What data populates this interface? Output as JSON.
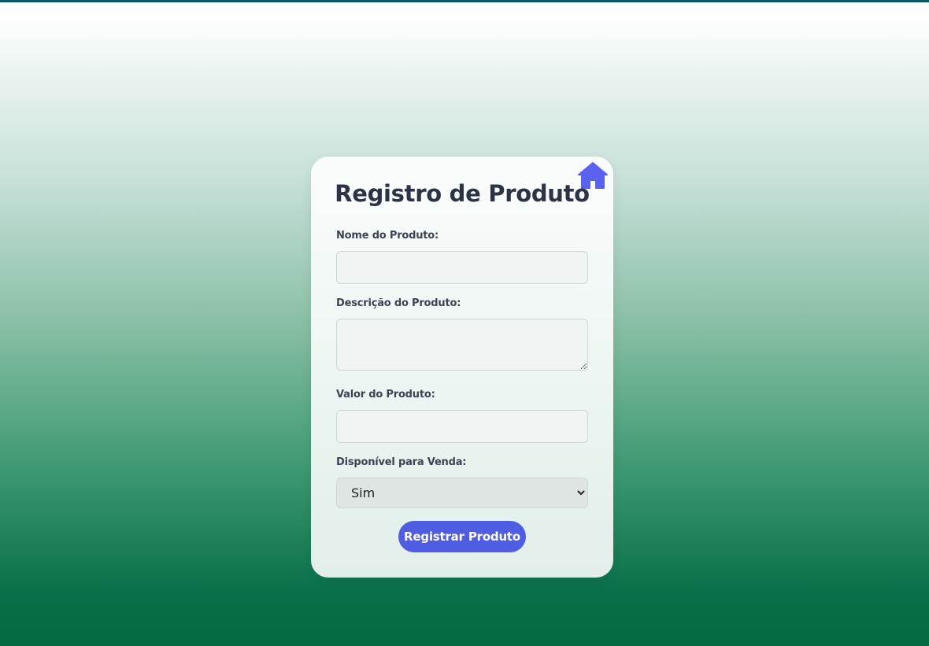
{
  "colors": {
    "accent": "#4f5de3",
    "title_text": "#2c3344",
    "label_text": "#3c4352",
    "top_bar": "#0a5a63"
  },
  "form": {
    "title": "Registro de Produto",
    "home_icon": "home-icon",
    "fields": {
      "name_label": "Nome do Produto:",
      "name_value": "",
      "description_label": "Descrição do Produto:",
      "description_value": "",
      "price_label": "Valor do Produto:",
      "price_value": "",
      "available_label": "Disponível para Venda:",
      "available_selected": "Sim"
    },
    "submit_label": "Registrar Produto"
  }
}
